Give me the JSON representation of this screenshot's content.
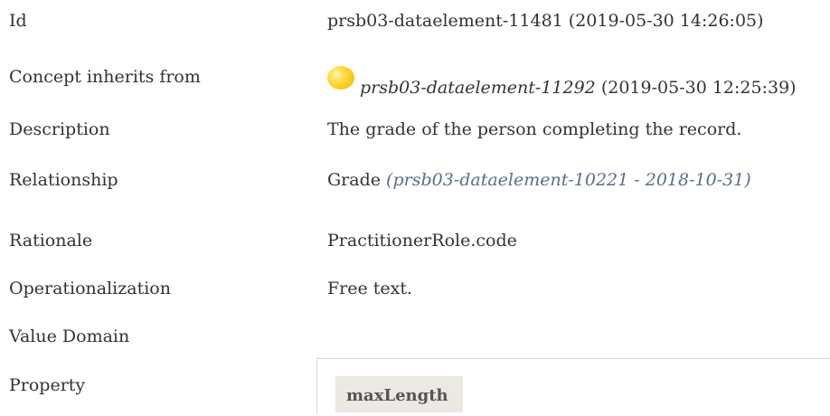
{
  "rows": [
    {
      "label": "Id",
      "value": "prsb03-dataelement-11481 (2019-05-30 14:26:05)"
    },
    {
      "label": "Concept inherits from",
      "inherits_id": "prsb03-dataelement-11292",
      "inherits_date": "(2019-05-30 12:25:39)"
    },
    {
      "label": "Description",
      "value": "The grade of the person completing the record."
    },
    {
      "label": "Relationship",
      "rel_name": "Grade",
      "rel_ref": "(prsb03-dataelement-10221 - 2018-10-31)"
    },
    {
      "label": "Rationale",
      "value": "PractitionerRole.code"
    },
    {
      "label": "Operationalization",
      "value": "Free text."
    },
    {
      "label": "Value Domain",
      "value": ""
    },
    {
      "label": "Property",
      "header": "maxLength"
    }
  ],
  "icons": {
    "inherits_status": "yellow-status-dot-icon",
    "inherits_color": "#ffd530"
  }
}
